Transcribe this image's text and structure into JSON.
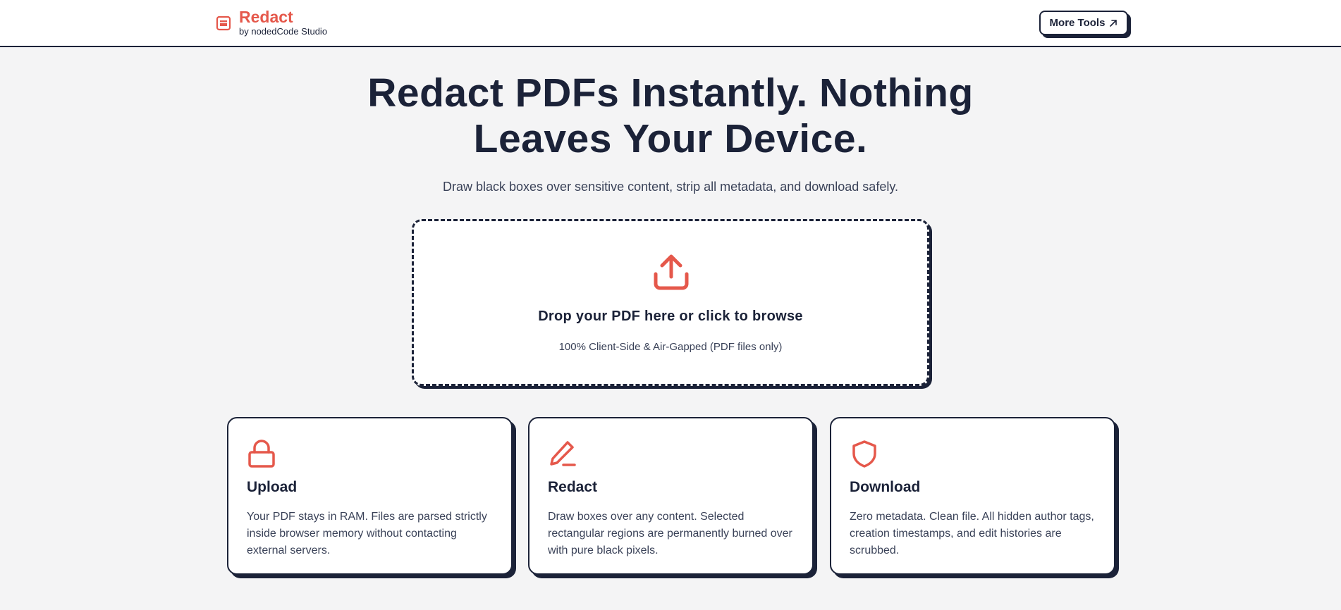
{
  "header": {
    "brand_title": "Redact",
    "brand_subtitle": "by nodedCode Studio",
    "more_tools_label": "More Tools",
    "brand_icon": "window-icon",
    "more_tools_icon": "arrow-up-right-icon"
  },
  "hero": {
    "title_line1": "Redact PDFs Instantly. Nothing",
    "title_line2": "Leaves Your Device.",
    "subtitle": "Draw black boxes over sensitive content, strip all metadata, and download safely."
  },
  "dropzone": {
    "icon": "upload-icon",
    "title": "Drop your PDF here or click to browse",
    "note": "100% Client-Side & Air-Gapped (PDF files only)"
  },
  "cards": [
    {
      "icon": "lock-icon",
      "title": "Upload",
      "text": "Your PDF stays in RAM. Files are parsed strictly inside browser memory without contacting external servers."
    },
    {
      "icon": "pen-icon",
      "title": "Redact",
      "text": "Draw boxes over any content. Selected rectangular regions are permanently burned over with pure black pixels."
    },
    {
      "icon": "shield-icon",
      "title": "Download",
      "text": "Zero metadata. Clean file. All hidden author tags, creation timestamps, and edit histories are scrubbed."
    }
  ],
  "colors": {
    "accent": "#e5584b",
    "ink": "#1b2238",
    "background": "#f4f4f5",
    "surface": "#ffffff"
  }
}
